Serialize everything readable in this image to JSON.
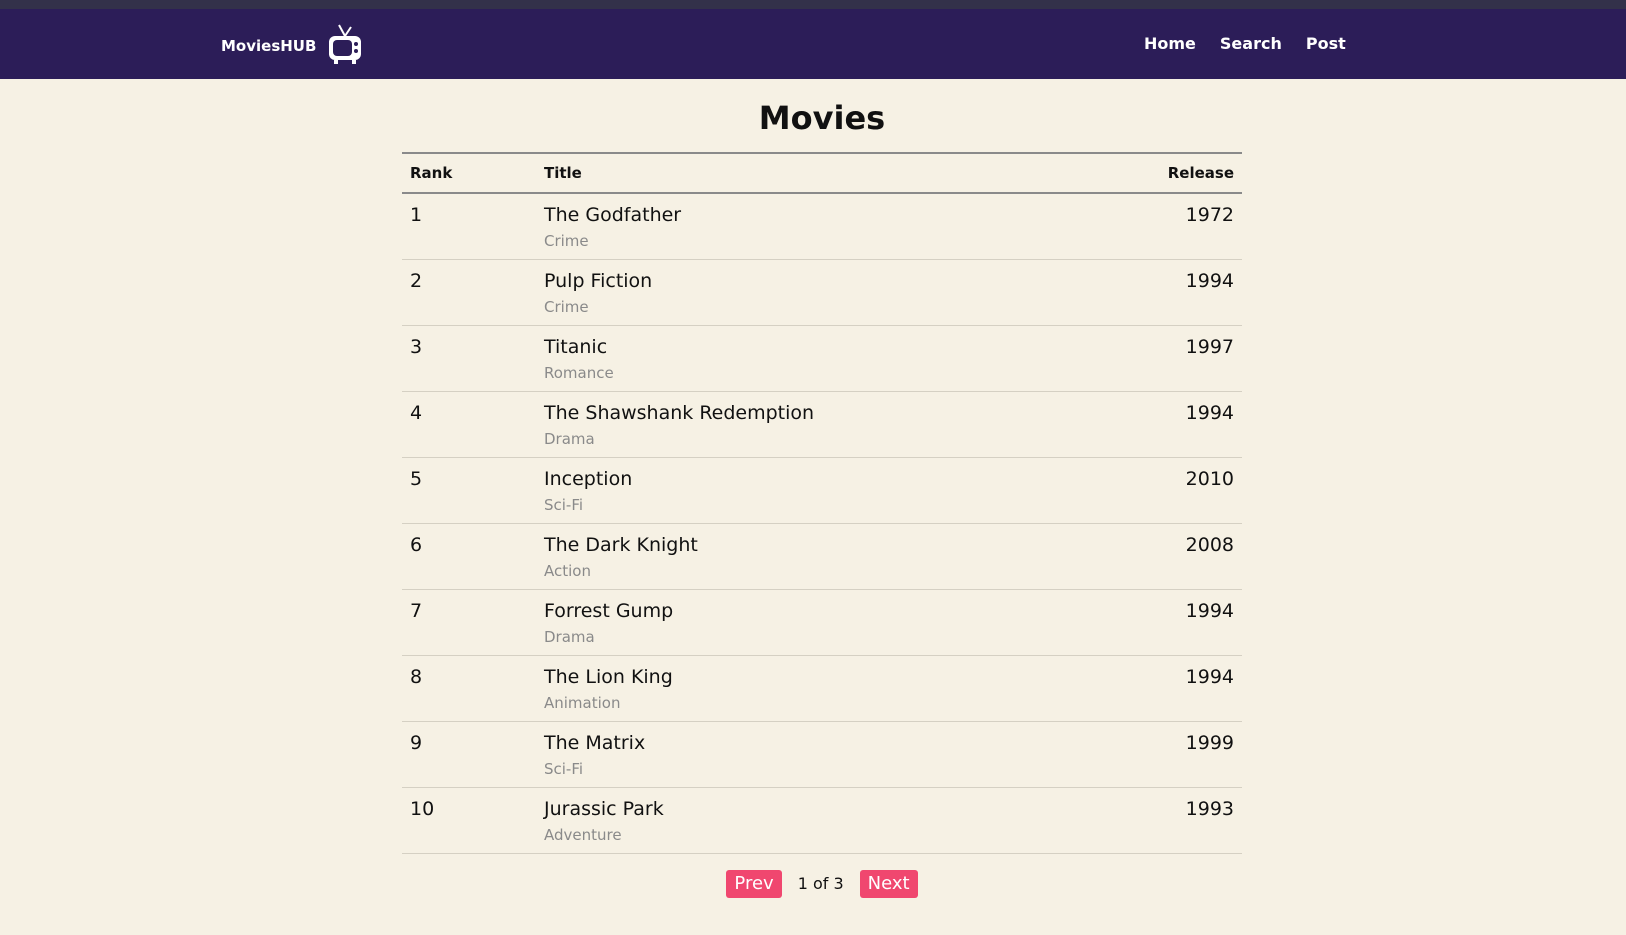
{
  "nav": {
    "brand": "MoviesHUB",
    "links": [
      "Home",
      "Search",
      "Post"
    ]
  },
  "main": {
    "title": "Movies",
    "columns": {
      "rank": "Rank",
      "title": "Title",
      "release": "Release"
    },
    "movies": [
      {
        "rank": "1",
        "title": "The Godfather",
        "genre": "Crime",
        "release": "1972"
      },
      {
        "rank": "2",
        "title": "Pulp Fiction",
        "genre": "Crime",
        "release": "1994"
      },
      {
        "rank": "3",
        "title": "Titanic",
        "genre": "Romance",
        "release": "1997"
      },
      {
        "rank": "4",
        "title": "The Shawshank Redemption",
        "genre": "Drama",
        "release": "1994"
      },
      {
        "rank": "5",
        "title": "Inception",
        "genre": "Sci-Fi",
        "release": "2010"
      },
      {
        "rank": "6",
        "title": "The Dark Knight",
        "genre": "Action",
        "release": "2008"
      },
      {
        "rank": "7",
        "title": "Forrest Gump",
        "genre": "Drama",
        "release": "1994"
      },
      {
        "rank": "8",
        "title": "The Lion King",
        "genre": "Animation",
        "release": "1994"
      },
      {
        "rank": "9",
        "title": "The Matrix",
        "genre": "Sci-Fi",
        "release": "1999"
      },
      {
        "rank": "10",
        "title": "Jurassic Park",
        "genre": "Adventure",
        "release": "1993"
      }
    ]
  },
  "pagination": {
    "prev": "Prev",
    "info": "1 of 3",
    "next": "Next"
  },
  "colors": {
    "navbar": "#2c1d58",
    "background": "#f6f1e4",
    "accent": "#f0476f"
  },
  "icons": {
    "brand": "tv-icon"
  }
}
